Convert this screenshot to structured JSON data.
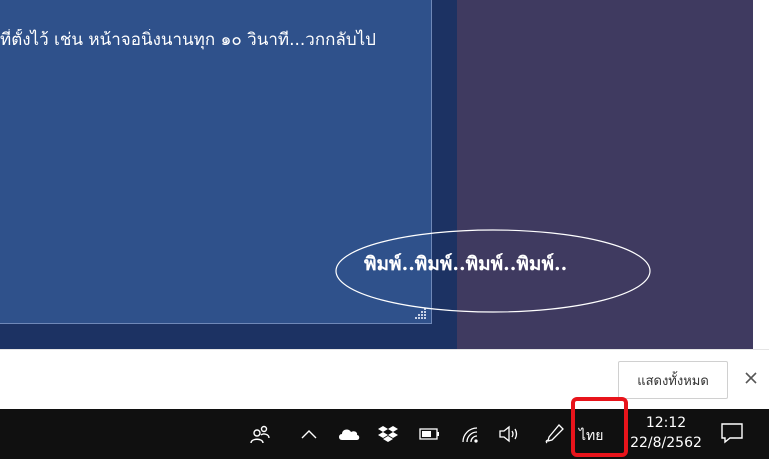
{
  "dialog": {
    "body_text": "ที่ตั้งไว้ เช่น หน้าจอนิ่งนานทุก ๑๐ วินาที...วกกลับไป"
  },
  "annotation": {
    "typing_text": "พิมพ์..พิมพ์..พิมพ์..พิมพ์..",
    "color": "#ffffff"
  },
  "notification": {
    "show_all_label": "แสดงทั้งหมด",
    "close_icon": "close-icon"
  },
  "taskbar": {
    "tray_icons": [
      "people-icon",
      "chevron-up-icon",
      "onedrive-cloud-icon",
      "dropbox-icon",
      "battery-icon",
      "wifi-icon",
      "volume-icon",
      "pen-icon"
    ],
    "language": "ไทย",
    "clock_time": "12:12",
    "clock_date": "22/8/2562",
    "highlight_color": "#e8141b"
  }
}
